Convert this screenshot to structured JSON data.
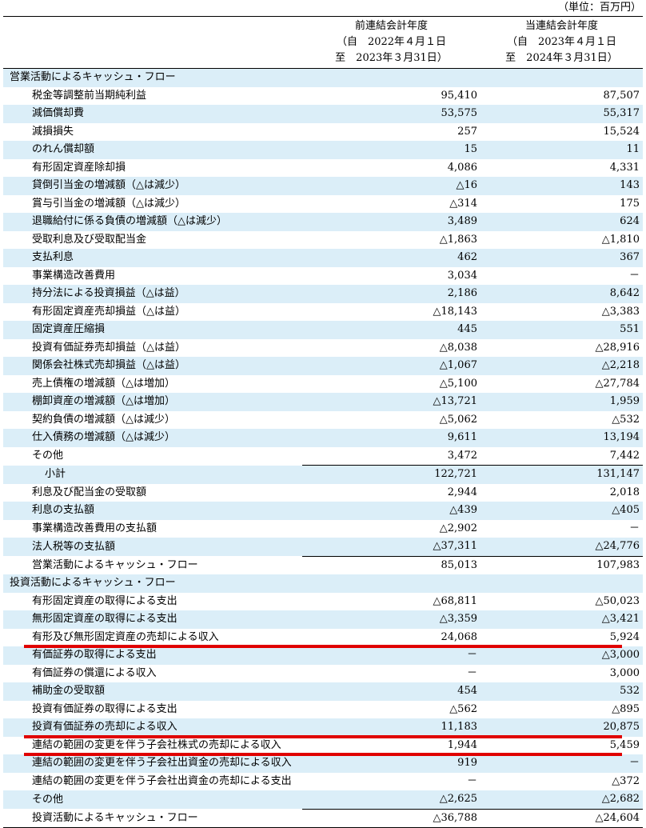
{
  "unit_label": "（単位：百万円）",
  "header": {
    "prev": {
      "year": "前連結会計年度",
      "from": "（自　2022年４月１日",
      "to": "至　2023年３月31日）"
    },
    "cur": {
      "year": "当連結会計年度",
      "from": "（自　2023年４月１日",
      "to": "至　2024年３月31日）"
    }
  },
  "rows": [
    {
      "label": "営業活動によるキャッシュ・フロー",
      "prev": "",
      "cur": "",
      "kind": "section"
    },
    {
      "label": "税金等調整前当期純利益",
      "prev": "95,410",
      "cur": "87,507"
    },
    {
      "label": "減価償却費",
      "prev": "53,575",
      "cur": "55,317"
    },
    {
      "label": "減損損失",
      "prev": "257",
      "cur": "15,524"
    },
    {
      "label": "のれん償却額",
      "prev": "15",
      "cur": "11"
    },
    {
      "label": "有形固定資産除却損",
      "prev": "4,086",
      "cur": "4,331"
    },
    {
      "label": "貸倒引当金の増減額（△は減少）",
      "prev": "△16",
      "cur": "143"
    },
    {
      "label": "賞与引当金の増減額（△は減少）",
      "prev": "△314",
      "cur": "175"
    },
    {
      "label": "退職給付に係る負債の増減額（△は減少）",
      "prev": "3,489",
      "cur": "624"
    },
    {
      "label": "受取利息及び受取配当金",
      "prev": "△1,863",
      "cur": "△1,810"
    },
    {
      "label": "支払利息",
      "prev": "462",
      "cur": "367"
    },
    {
      "label": "事業構造改善費用",
      "prev": "3,034",
      "cur": "－"
    },
    {
      "label": "持分法による投資損益（△は益）",
      "prev": "2,186",
      "cur": "8,642"
    },
    {
      "label": "有形固定資産売却損益（△は益）",
      "prev": "△18,143",
      "cur": "△3,383"
    },
    {
      "label": "固定資産圧縮損",
      "prev": "445",
      "cur": "551"
    },
    {
      "label": "投資有価証券売却損益（△は益）",
      "prev": "△8,038",
      "cur": "△28,916"
    },
    {
      "label": "関係会社株式売却損益（△は益）",
      "prev": "△1,067",
      "cur": "△2,218"
    },
    {
      "label": "売上債権の増減額（△は増加）",
      "prev": "△5,100",
      "cur": "△27,784"
    },
    {
      "label": "棚卸資産の増減額（△は増加）",
      "prev": "△13,721",
      "cur": "1,959"
    },
    {
      "label": "契約負債の増減額（△は減少）",
      "prev": "△5,062",
      "cur": "△532"
    },
    {
      "label": "仕入債務の増減額（△は減少）",
      "prev": "9,611",
      "cur": "13,194"
    },
    {
      "label": "その他",
      "prev": "3,472",
      "cur": "7,442"
    },
    {
      "label": "小計",
      "prev": "122,721",
      "cur": "131,147",
      "kind": "subtotal"
    },
    {
      "label": "利息及び配当金の受取額",
      "prev": "2,944",
      "cur": "2,018"
    },
    {
      "label": "利息の支払額",
      "prev": "△439",
      "cur": "△405"
    },
    {
      "label": "事業構造改善費用の支払額",
      "prev": "△2,902",
      "cur": "－"
    },
    {
      "label": "法人税等の支払額",
      "prev": "△37,311",
      "cur": "△24,776"
    },
    {
      "label": "営業活動によるキャッシュ・フロー",
      "prev": "85,013",
      "cur": "107,983",
      "kind": "total"
    },
    {
      "label": "投資活動によるキャッシュ・フロー",
      "prev": "",
      "cur": "",
      "kind": "section"
    },
    {
      "label": "有形固定資産の取得による支出",
      "prev": "△68,811",
      "cur": "△50,023"
    },
    {
      "label": "無形固定資産の取得による支出",
      "prev": "△3,359",
      "cur": "△3,421"
    },
    {
      "label": "有形及び無形固定資産の売却による収入",
      "prev": "24,068",
      "cur": "5,924"
    },
    {
      "label": "有価証券の取得による支出",
      "prev": "－",
      "cur": "△3,000"
    },
    {
      "label": "有価証券の償還による収入",
      "prev": "－",
      "cur": "3,000"
    },
    {
      "label": "補助金の受取額",
      "prev": "454",
      "cur": "532"
    },
    {
      "label": "投資有価証券の取得による支出",
      "prev": "△562",
      "cur": "△895"
    },
    {
      "label": "投資有価証券の売却による収入",
      "prev": "11,183",
      "cur": "20,875"
    },
    {
      "label": "連結の範囲の変更を伴う子会社株式の売却による収入",
      "prev": "1,944",
      "cur": "5,459",
      "kind": "tall"
    },
    {
      "label": "連結の範囲の変更を伴う子会社出資金の売却による収入",
      "prev": "919",
      "cur": "－",
      "kind": "tall"
    },
    {
      "label": "連結の範囲の変更を伴う子会社出資金の売却による支出",
      "prev": "－",
      "cur": "△372",
      "kind": "tall"
    },
    {
      "label": "その他",
      "prev": "△2,625",
      "cur": "△2,682"
    },
    {
      "label": "投資活動によるキャッシュ・フロー",
      "prev": "△36,788",
      "cur": "△24,604",
      "kind": "total"
    }
  ]
}
